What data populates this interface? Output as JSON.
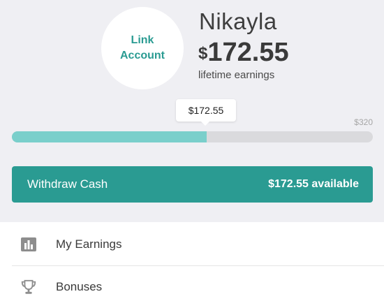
{
  "account": {
    "link_label_line1": "Link",
    "link_label_line2": "Account"
  },
  "user": {
    "name": "Nikayla",
    "currency_symbol": "$",
    "lifetime_amount": "172.55",
    "lifetime_label": "lifetime earnings"
  },
  "progress": {
    "current_label": "$172.55",
    "goal_label": "$320",
    "current_value": 172.55,
    "goal_value": 320
  },
  "withdraw": {
    "label": "Withdraw Cash",
    "available_label": "$172.55 available"
  },
  "menu": {
    "items": [
      {
        "label": "My Earnings",
        "icon": "bar-chart-icon"
      },
      {
        "label": "Bonuses",
        "icon": "trophy-icon"
      }
    ]
  },
  "colors": {
    "accent": "#2a9b92",
    "progress_fill": "#7acfcb",
    "progress_track": "#dadadd",
    "panel_background": "#efeff3"
  }
}
